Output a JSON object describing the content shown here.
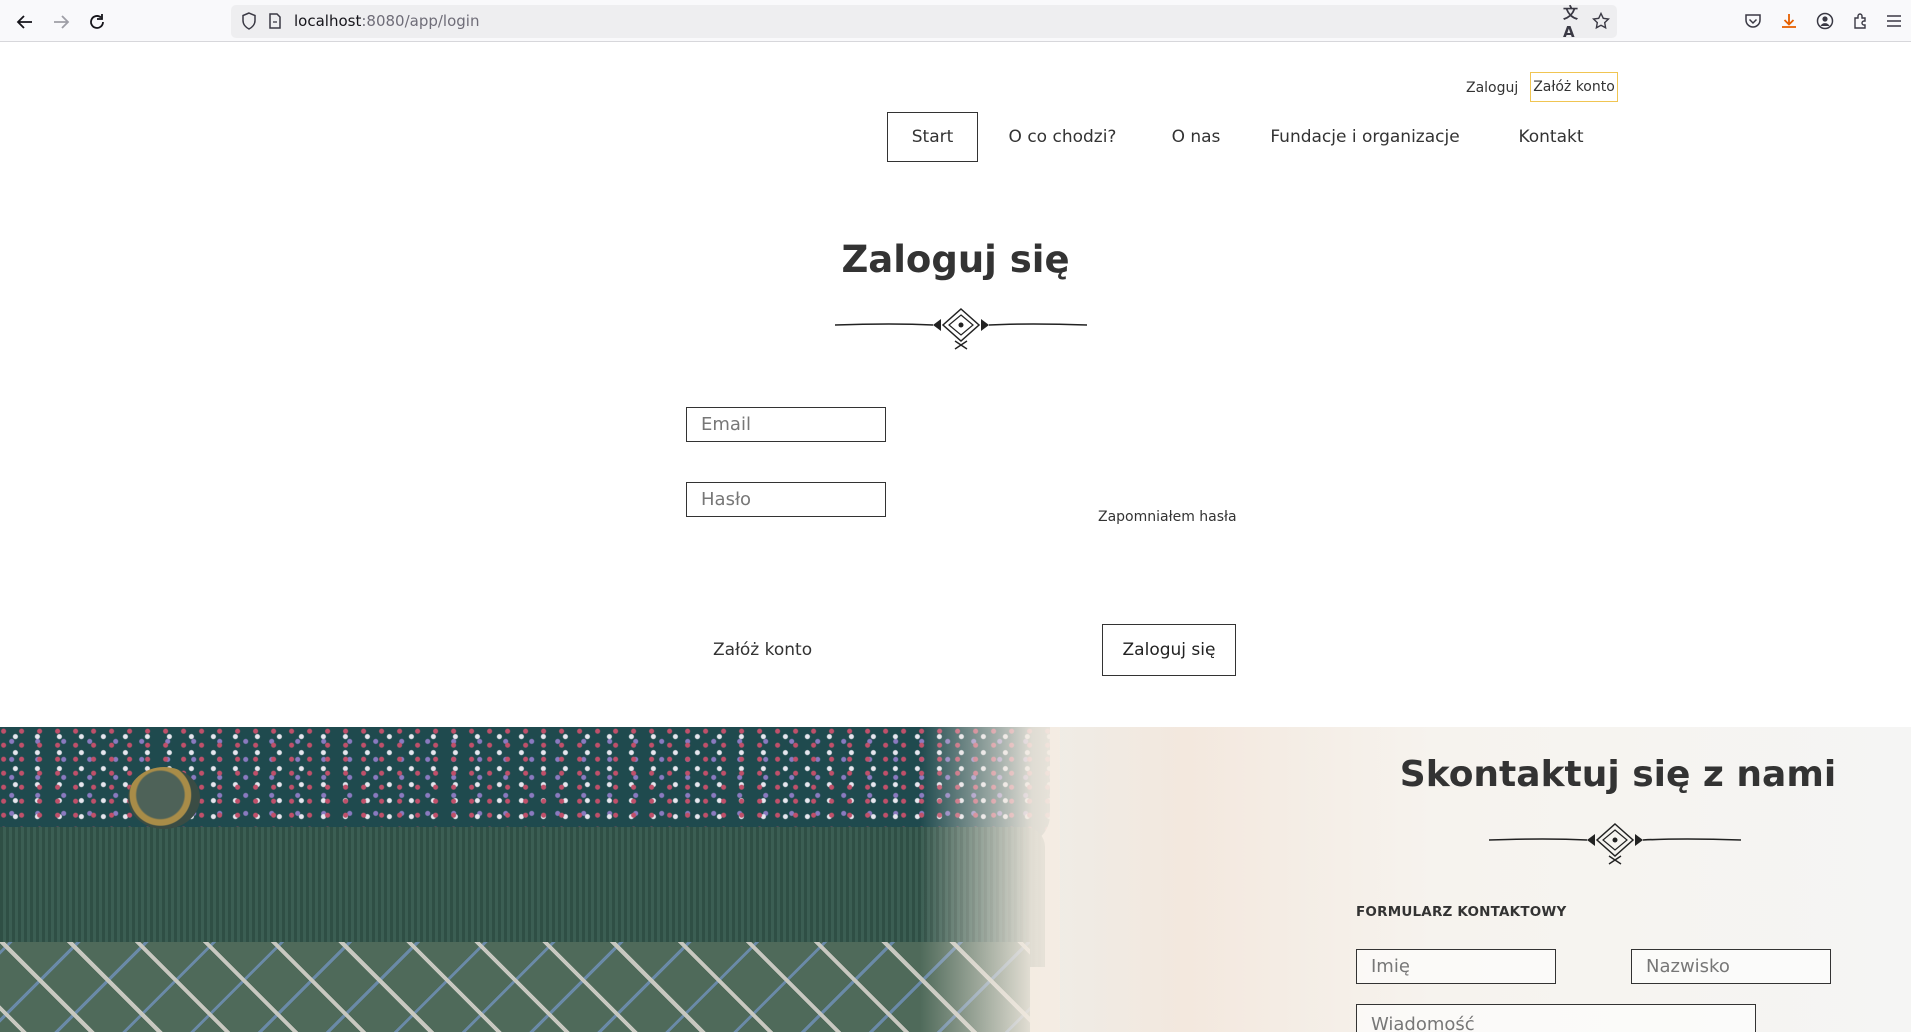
{
  "browser": {
    "url_host": "localhost",
    "url_rest": ":8080/app/login",
    "icons": [
      "back-icon",
      "forward-icon",
      "reload-icon",
      "shield-icon",
      "page-icon",
      "translate-icon",
      "star-icon",
      "pocket-icon",
      "download-icon",
      "account-icon",
      "extensions-icon",
      "menu-icon"
    ]
  },
  "header": {
    "login_link": "Zaloguj",
    "signup_link": "Załóż konto",
    "menu": [
      {
        "label": "Start",
        "active": true
      },
      {
        "label": "O co chodzi?"
      },
      {
        "label": "O nas"
      },
      {
        "label": "Fundacje i organizacje"
      },
      {
        "label": "Kontakt"
      }
    ]
  },
  "login": {
    "title": "Zaloguj się",
    "email_placeholder": "Email",
    "password_placeholder": "Hasło",
    "forgot_link": "Zapomniałem hasła",
    "signup_button": "Załóż konto",
    "submit_button": "Zaloguj się"
  },
  "contact": {
    "title": "Skontaktuj się z nami",
    "form_label": "FORMULARZ KONTAKTOWY",
    "first_name_placeholder": "Imię",
    "last_name_placeholder": "Nazwisko",
    "message_placeholder": "Wiadomość"
  },
  "colors": {
    "accent_border": "#f0c552",
    "text": "#333333",
    "download_icon": "#e66000"
  }
}
